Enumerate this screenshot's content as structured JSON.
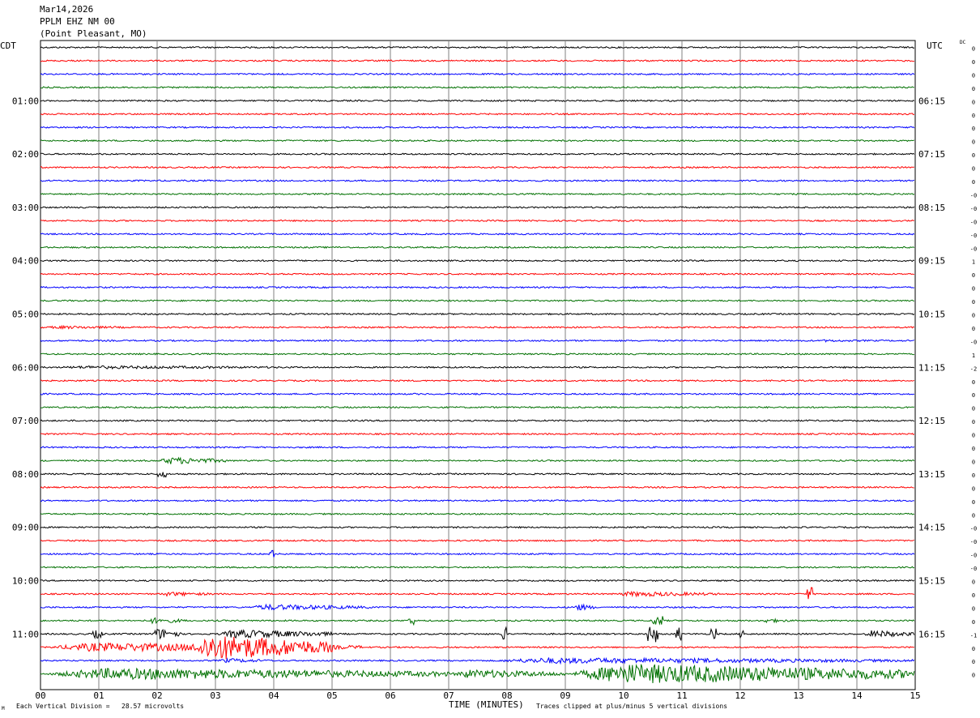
{
  "header": {
    "date": "Mar14,2026",
    "station": "PPLM EHZ NM 00",
    "location": "(Point Pleasant, MO)"
  },
  "left_tz": "CDT",
  "right_tz": "UTC",
  "dc_label": "DC",
  "footer": {
    "scale_note": "Each Vertical Division =   28.57 microvolts",
    "clip_note": "Traces clipped at plus/minus 5 vertical divisions",
    "corner_mark": "M"
  },
  "colors": {
    "trace_cycle": [
      "#000000",
      "#ff0000",
      "#0000ff",
      "#007000"
    ],
    "grid": "#808080"
  },
  "chart_data": {
    "type": "line",
    "title": "",
    "xlabel": "TIME (MINUTES)",
    "ylabel": "",
    "x_ticks": [
      "00",
      "01",
      "02",
      "03",
      "04",
      "05",
      "06",
      "07",
      "08",
      "09",
      "10",
      "11",
      "12",
      "13",
      "14",
      "15"
    ],
    "x_range": [
      0,
      15
    ],
    "grid": true,
    "traces_per_hour": 4,
    "minutes_per_trace": 15,
    "left_hour_labels": [
      "01:00",
      "02:00",
      "03:00",
      "04:00",
      "05:00",
      "06:00",
      "07:00",
      "08:00",
      "09:00",
      "10:00",
      "11:00"
    ],
    "right_hour_labels": [
      "06:15",
      "07:15",
      "08:15",
      "09:15",
      "10:15",
      "11:15",
      "12:15",
      "13:15",
      "14:15",
      "15:15",
      "16:15"
    ],
    "dc_offsets": [
      "0",
      "0",
      "0",
      "0",
      "0",
      "0",
      "0",
      "0",
      "0",
      "0",
      "0",
      "-0",
      "-0",
      "-0",
      "-0",
      "-0",
      "1",
      "0",
      "0",
      "0",
      "0",
      "0",
      "-0",
      "1",
      "-2",
      "0",
      "0",
      "0",
      "0",
      "0",
      "0",
      "0",
      "0",
      "0",
      "0",
      "0",
      "-0",
      "-0",
      "-0",
      "-0",
      "0",
      "0",
      "0",
      "0",
      "-1",
      "0",
      "0",
      "0"
    ],
    "events": [
      {
        "trace": 21,
        "from": 0.0,
        "to": 1.8,
        "amp": 2.2
      },
      {
        "trace": 22,
        "from": 13.2,
        "to": 14.8,
        "amp": 1.6
      },
      {
        "trace": 24,
        "from": 0.0,
        "to": 5.0,
        "amp": 2.2
      },
      {
        "trace": 31,
        "from": 2.0,
        "to": 3.2,
        "amp": 5
      },
      {
        "trace": 32,
        "from": 2.0,
        "to": 2.15,
        "amp": 4
      },
      {
        "trace": 38,
        "from": 3.9,
        "to": 4.0,
        "amp": 5
      },
      {
        "trace": 41,
        "from": 2.0,
        "to": 3.0,
        "amp": 3
      },
      {
        "trace": 41,
        "from": 9.8,
        "to": 11.7,
        "amp": 3.5
      },
      {
        "trace": 41,
        "from": 13.15,
        "to": 13.25,
        "amp": 8
      },
      {
        "trace": 42,
        "from": 3.5,
        "to": 5.7,
        "amp": 4
      },
      {
        "trace": 42,
        "from": 9.1,
        "to": 9.5,
        "amp": 5
      },
      {
        "trace": 43,
        "from": 1.8,
        "to": 2.5,
        "amp": 4
      },
      {
        "trace": 43,
        "from": 6.3,
        "to": 6.4,
        "amp": 5
      },
      {
        "trace": 43,
        "from": 10.5,
        "to": 10.7,
        "amp": 6
      },
      {
        "trace": 43,
        "from": 12.3,
        "to": 12.9,
        "amp": 3
      },
      {
        "trace": 44,
        "from": 0.9,
        "to": 1.1,
        "amp": 5
      },
      {
        "trace": 44,
        "from": 1.9,
        "to": 2.4,
        "amp": 8
      },
      {
        "trace": 44,
        "from": 3.0,
        "to": 5.0,
        "amp": 6
      },
      {
        "trace": 44,
        "from": 7.9,
        "to": 8.0,
        "amp": 8
      },
      {
        "trace": 44,
        "from": 10.4,
        "to": 10.6,
        "amp": 10
      },
      {
        "trace": 44,
        "from": 10.9,
        "to": 11.0,
        "amp": 8
      },
      {
        "trace": 44,
        "from": 11.5,
        "to": 11.6,
        "amp": 8
      },
      {
        "trace": 44,
        "from": 12.0,
        "to": 12.1,
        "amp": 6
      },
      {
        "trace": 44,
        "from": 14.1,
        "to": 15.0,
        "amp": 5
      },
      {
        "trace": 45,
        "from": 0.0,
        "to": 5.5,
        "amp": 6
      },
      {
        "trace": 45,
        "from": 2.5,
        "to": 5.0,
        "amp": 18
      },
      {
        "trace": 46,
        "from": 3.0,
        "to": 4.0,
        "amp": 3
      },
      {
        "trace": 46,
        "from": 7.5,
        "to": 15.0,
        "amp": 4
      },
      {
        "trace": 47,
        "from": 0.0,
        "to": 7.0,
        "amp": 8
      },
      {
        "trace": 47,
        "from": 7.0,
        "to": 9.0,
        "amp": 6
      },
      {
        "trace": 47,
        "from": 9.0,
        "to": 15.0,
        "amp": 14
      }
    ]
  }
}
